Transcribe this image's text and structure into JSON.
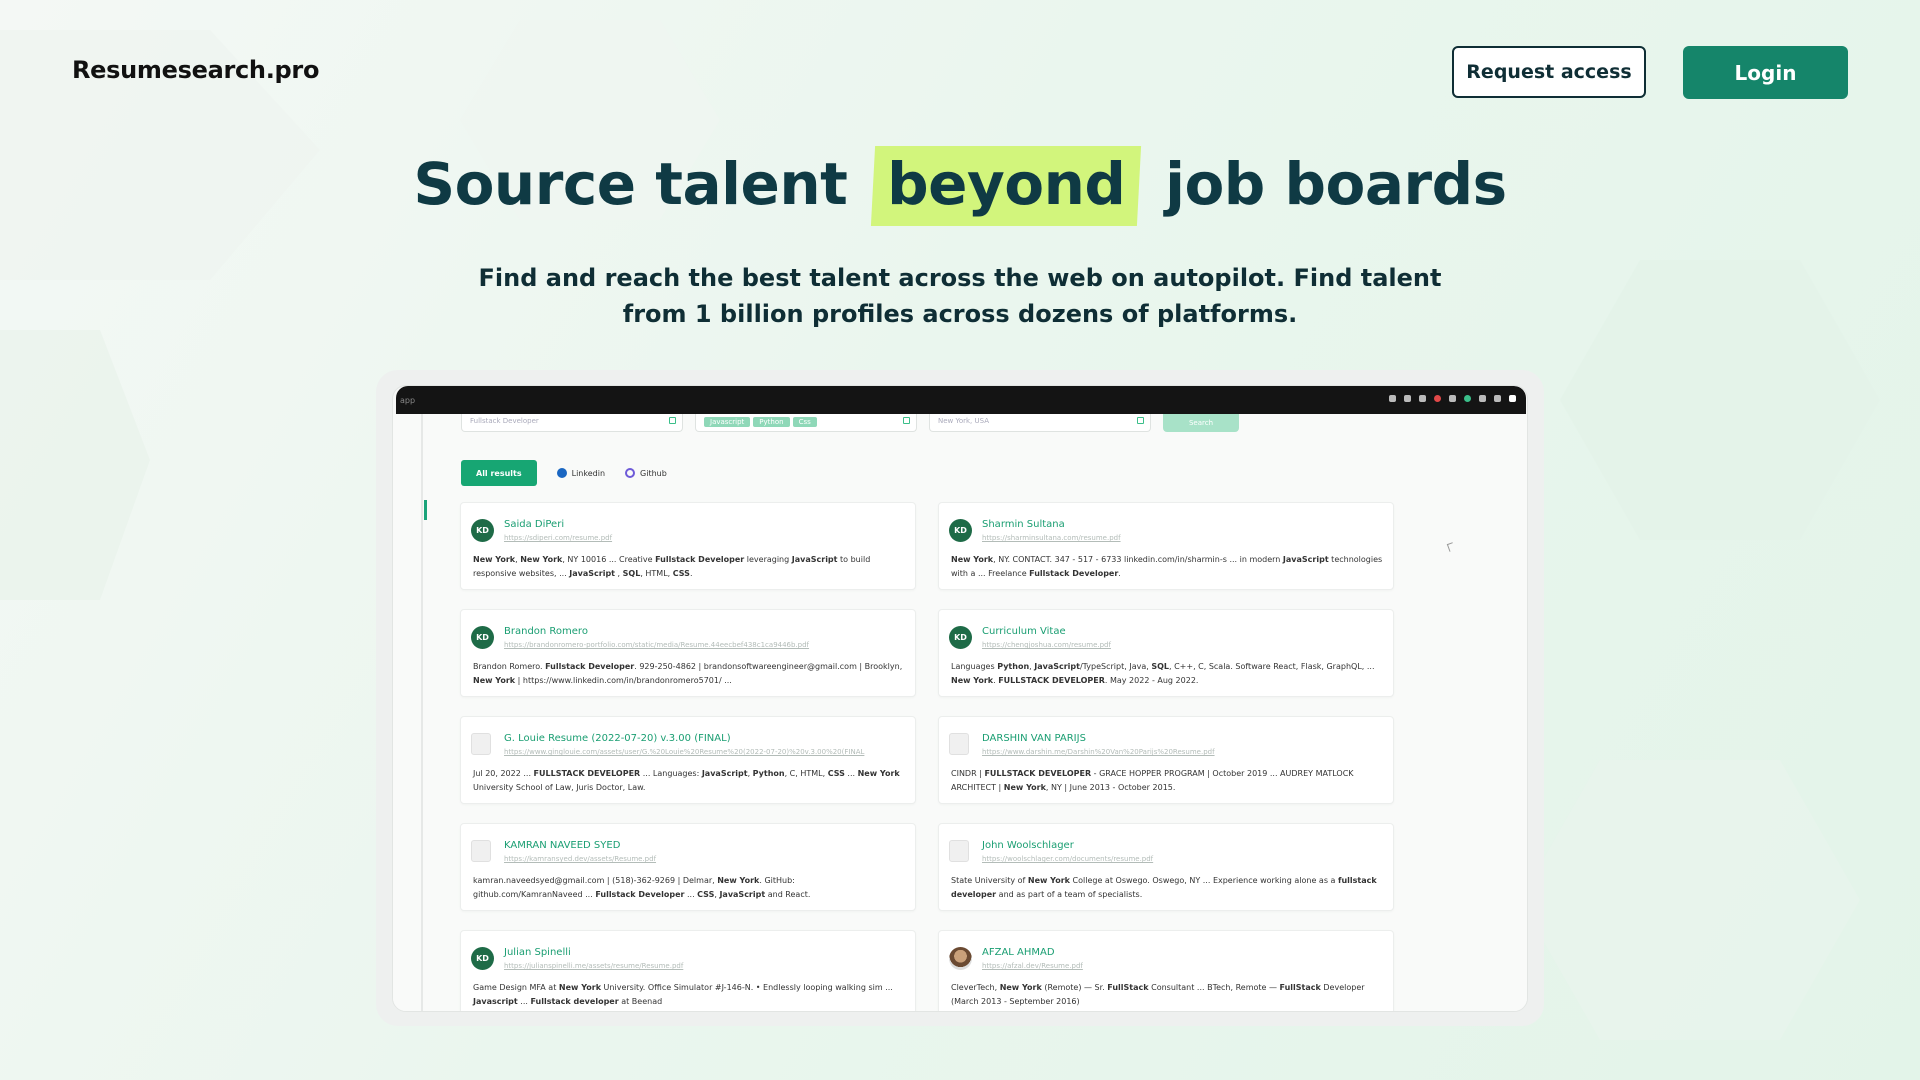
{
  "header": {
    "brand": "Resumesearch.pro",
    "request_access": "Request access",
    "login": "Login"
  },
  "hero": {
    "title_before": "Source talent",
    "title_highlight": "beyond",
    "title_after": "job boards",
    "subtitle": "Find and reach the best talent across the web on autopilot. Find talent from 1 billion profiles across dozens of platforms."
  },
  "colors": {
    "accent": "#15856a",
    "highlight": "#d2f57c",
    "title": "#0f3a44"
  },
  "app": {
    "url_text": "app",
    "search": {
      "query": "Fullstack Developer",
      "tags": [
        "Javascript",
        "Python",
        "Css"
      ],
      "location": "New York, USA",
      "button": "Search"
    },
    "tabs": [
      {
        "label": "All results",
        "active": true
      },
      {
        "label": "Linkedin",
        "icon": "linkedin-icon"
      },
      {
        "label": "Github",
        "icon": "github-icon"
      }
    ],
    "results": [
      {
        "avatar": "KD",
        "title": "Saida DiPeri",
        "url": "https://sdiperi.com/resume.pdf",
        "snippet": "New York, New York, NY 10016 ... Creative Fullstack Developer leveraging JavaScript to build responsive websites, ... JavaScript , SQL, HTML, CSS."
      },
      {
        "avatar": "KD",
        "title": "Sharmin Sultana",
        "url": "https://sharminsultana.com/resume.pdf",
        "snippet": "New York, NY. CONTACT. 347 - 517 - 6733 linkedin.com/in/sharmin-s ... in modern JavaScript technologies with a ... Freelance Fullstack Developer."
      },
      {
        "avatar": "KD",
        "title": "Brandon Romero",
        "url": "https://brandonromero-portfolio.com/static/media/Resume.44eecbef438c1ca9446b.pdf",
        "snippet": "Brandon Romero. Fullstack Developer. 929-250-4862 | brandonsoftwareengineer@gmail.com | Brooklyn, New York | https://www.linkedin.com/in/brandonromero5701/ ..."
      },
      {
        "avatar": "KD",
        "title": "Curriculum Vitae",
        "url": "https://chengjoshua.com/resume.pdf",
        "snippet": "Languages Python, JavaScript/TypeScript, Java, SQL, C++, C, Scala. Software React, Flask, GraphQL, ... New York. FULLSTACK DEVELOPER. May 2022 - Aug 2022."
      },
      {
        "avatar": "",
        "title": "G. Louie Resume (2022-07-20) v.3.00 (FINAL)",
        "url": "https://www.ginglouie.com/assets/user/G.%20Louie%20Resume%20(2022-07-20)%20v.3.00%20(FINAL",
        "snippet": "Jul 20, 2022 ... FULLSTACK DEVELOPER ... Languages: JavaScript, Python, C, HTML, CSS ... New York University School of Law, Juris Doctor, Law."
      },
      {
        "avatar": "",
        "title": "DARSHIN VAN PARIJS",
        "url": "https://www.darshin.me/Darshin%20Van%20Parijs%20Resume.pdf",
        "snippet": "CINDR | FULLSTACK DEVELOPER - GRACE HOPPER PROGRAM | October 2019 ... AUDREY MATLOCK ARCHITECT | New York, NY | June 2013 - October 2015."
      },
      {
        "avatar": "",
        "title": "KAMRAN NAVEED SYED",
        "url": "https://kamransyed.dev/assets/Resume.pdf",
        "snippet": "kamran.naveedsyed@gmail.com | (518)-362-9269 | Delmar, New York. GitHub: github.com/KamranNaveed ... Fullstack Developer ... CSS, JavaScript and React."
      },
      {
        "avatar": "",
        "title": "John Woolschlager",
        "url": "https://woolschlager.com/documents/resume.pdf",
        "snippet": "State University of New York College at Oswego. Oswego, NY ... Experience working alone as a fullstack developer and as part of a team of specialists."
      },
      {
        "avatar": "KD",
        "title": "Julian Spinelli",
        "url": "https://julianspinelli.me/assets/resume/Resume.pdf",
        "snippet": "Game Design MFA at New York University. Office Simulator #J-146-N. • Endlessly looping walking sim ... Javascript ... Fullstack developer at Beenad"
      },
      {
        "avatar": "photo",
        "title": "AFZAL AHMAD",
        "url": "https://afzal.dev/Resume.pdf",
        "snippet": "CleverTech, New York (Remote) — Sr. FullStack Consultant ... BTech, Remote — FullStack Developer (March 2013 - September 2016)"
      }
    ]
  }
}
